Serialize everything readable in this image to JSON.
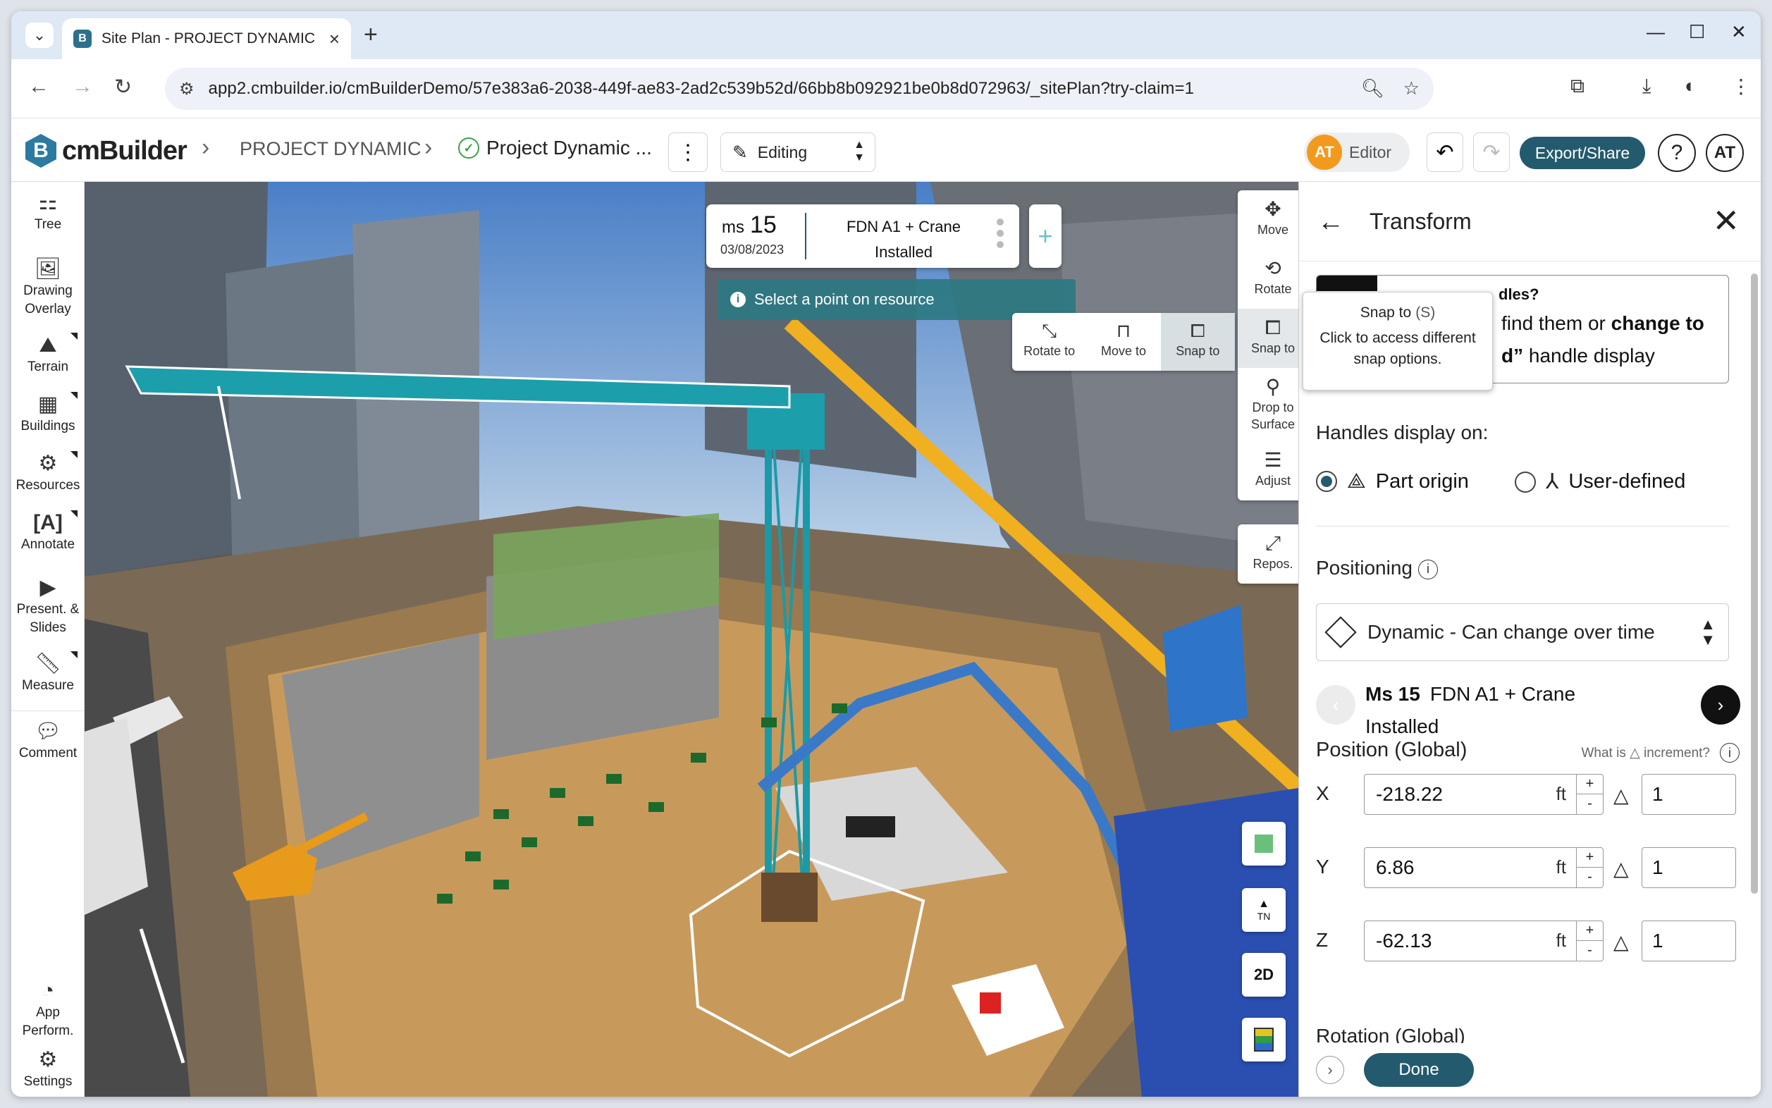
{
  "browser": {
    "tab_title": "Site Plan - PROJECT DYNAMIC",
    "url": "app2.cmbuilder.io/cmBuilderDemo/57e383a6-2038-449f-ae83-2ad2c539b52d/66bb8b092921be0b8d072963/_sitePlan?try-claim=1"
  },
  "header": {
    "logo": "cmBuilder",
    "breadcrumb_project": "PROJECT DYNAMIC",
    "breadcrumb_plan": "Project Dynamic ...",
    "mode": "Editing",
    "editor_initials": "AT",
    "editor_label": "Editor",
    "export_label": "Export/Share",
    "help": "?",
    "user_initials": "AT"
  },
  "rail": [
    {
      "label": "Tree",
      "icon": "tree-icon"
    },
    {
      "label": "Drawing Overlay",
      "icon": "drawing-overlay-icon"
    },
    {
      "label": "Terrain",
      "icon": "terrain-icon"
    },
    {
      "label": "Buildings",
      "icon": "buildings-icon"
    },
    {
      "label": "Resources",
      "icon": "resources-icon"
    },
    {
      "label": "Annotate",
      "icon": "annotate-icon"
    },
    {
      "label": "Present. & Slides",
      "icon": "present-icon"
    },
    {
      "label": "Measure",
      "icon": "measure-icon"
    },
    {
      "label": "Comment",
      "icon": "comment-icon"
    },
    {
      "label": "App Perform.",
      "icon": "app-performance-icon"
    },
    {
      "label": "Settings",
      "icon": "settings-icon"
    }
  ],
  "viewport": {
    "milestone_prefix": "ms",
    "milestone_num": "15",
    "milestone_date": "03/08/2023",
    "milestone_name_1": "FDN A1 + Crane",
    "milestone_name_2": "Installed",
    "hint": "Select a point on resource",
    "sub_tools": [
      "Rotate to",
      "Move to",
      "Snap to"
    ],
    "tools": [
      "Move",
      "Rotate",
      "Snap to",
      "Drop to Surface",
      "Adjust"
    ],
    "repos": "Repos.",
    "tooltip_title": "Snap to",
    "tooltip_key": "(S)",
    "tooltip_body": "Click to access different snap options.",
    "compass": "TN",
    "view_mode": "2D"
  },
  "panel": {
    "title": "Transform",
    "notice_l1": "dles?",
    "notice_l2_a": "find them or ",
    "notice_l2_b": "change to",
    "notice_l3_a": "d”",
    "notice_l3_b": " handle display",
    "handles_label": "Handles display on:",
    "handle_opt1": "Part origin",
    "handle_opt2": "User-defined",
    "positioning_label": "Positioning",
    "positioning_value": "Dynamic - Can change over time",
    "ms_label": "Ms 15",
    "ms_name": "FDN A1 + Crane",
    "ms_status": "Installed",
    "position_label": "Position (Global)",
    "increment_q": "What is △ increment?",
    "x_label": "X",
    "x_value": "-218.22",
    "y_label": "Y",
    "y_value": "6.86",
    "z_label": "Z",
    "z_value": "-62.13",
    "unit": "ft",
    "inc_x": "1",
    "inc_y": "1",
    "inc_z": "1",
    "rotation_label": "Rotation (Global)",
    "done": "Done"
  },
  "colors": {
    "accent": "#245a6e",
    "editor_avatar": "#f29a1e",
    "hint_bg": "#2d7882"
  }
}
